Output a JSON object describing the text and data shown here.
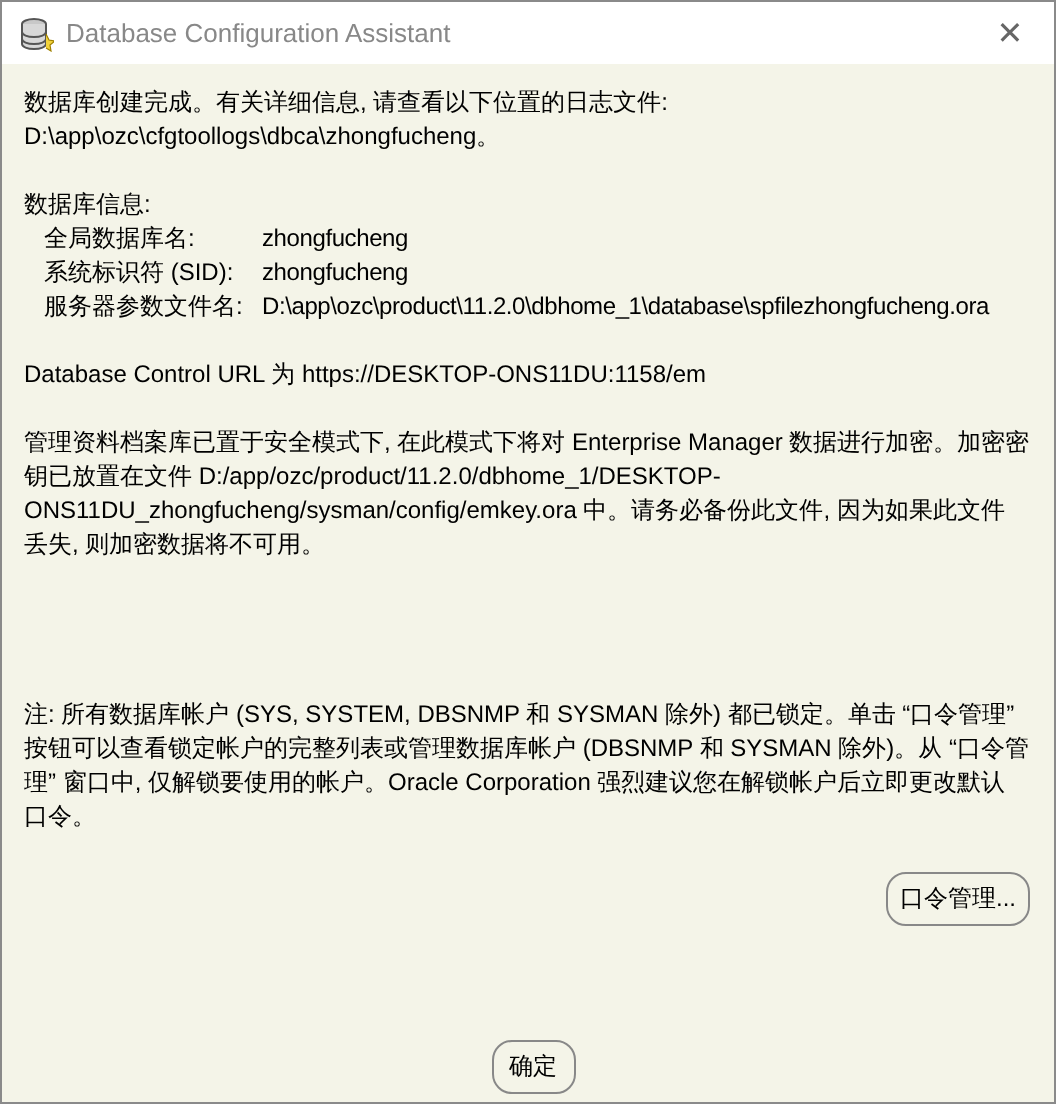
{
  "window": {
    "title": "Database Configuration Assistant",
    "close": "✕"
  },
  "completion": {
    "lines": [
      "数据库创建完成。有关详细信息, 请查看以下位置的日志文件:",
      " D:\\app\\ozc\\cfgtoollogs\\dbca\\zhongfucheng。"
    ]
  },
  "database_info": {
    "heading": "数据库信息:",
    "rows": [
      {
        "label": "全局数据库名:",
        "value": "zhongfucheng"
      },
      {
        "label": "系统标识符 (SID):",
        "value": "zhongfucheng"
      },
      {
        "label": "服务器参数文件名:",
        "value": "D:\\app\\ozc\\product\\11.2.0\\dbhome_1\\database\\spfilezhongfucheng.ora"
      }
    ]
  },
  "control_url": "Database Control URL 为 https://DESKTOP-ONS11DU:1158/em",
  "encryption_note": {
    "lines": [
      "管理资料档案库已置于安全模式下, 在此模式下将对 Enterprise Manager 数据进行加密。加密密",
      "钥已放置在文件 D:/app/ozc/product/11.2.0/dbhome_1/DESKTOP-",
      "ONS11DU_zhongfucheng/sysman/config/emkey.ora 中。请务必备份此文件, 因为如果此文件",
      "丢失, 则加密数据将不可用。"
    ]
  },
  "accounts_note": {
    "lines": [
      "注: 所有数据库帐户 (SYS, SYSTEM, DBSNMP 和 SYSMAN 除外) 都已锁定。单击 “口令管理”",
      "按钮可以查看锁定帐户的完整列表或管理数据库帐户 (DBSNMP 和 SYSMAN 除外)。从 “口令管",
      "理” 窗口中, 仅解锁要使用的帐户。Oracle Corporation 强烈建议您在解锁帐户后立即更改默认",
      "口令。"
    ]
  },
  "password_button": "口令管理...",
  "ok_button": "确定"
}
